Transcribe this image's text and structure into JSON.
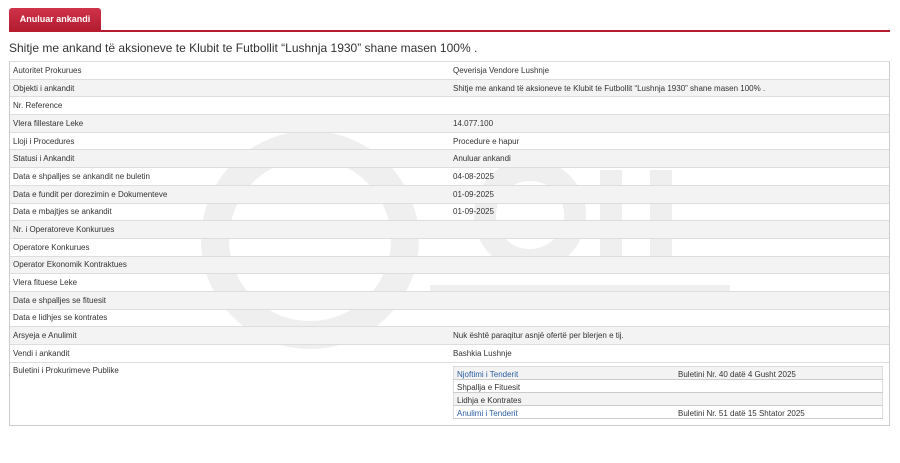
{
  "tab": {
    "label": "Anuluar ankandi"
  },
  "title": "Shitje me ankand të aksioneve te Klubit te Futbollit “Lushnja 1930” shane masen 100% .",
  "rows": [
    {
      "label": "Autoritet Prokurues",
      "value": "Qeverisja Vendore Lushnje"
    },
    {
      "label": "Objekti i ankandit",
      "value": "Shitje me ankand të aksioneve te Klubit te Futbollit “Lushnja 1930” shane masen 100% ."
    },
    {
      "label": "Nr. Reference",
      "value": ""
    },
    {
      "label": "Vlera fillestare Leke",
      "value": "14.077.100"
    },
    {
      "label": "Lloji i Procedures",
      "value": "Procedure e hapur"
    },
    {
      "label": "Statusi i Ankandit",
      "value": "Anuluar ankandi"
    },
    {
      "label": "Data e shpalljes se ankandit ne buletin",
      "value": "04-08-2025"
    },
    {
      "label": "Data e fundit per dorezimin e Dokumenteve",
      "value": "01-09-2025"
    },
    {
      "label": "Data e mbajtjes se ankandit",
      "value": "01-09-2025"
    },
    {
      "label": "Nr. i Operatoreve Konkurues",
      "value": ""
    },
    {
      "label": "Operatore Konkurues",
      "value": ""
    },
    {
      "label": "Operator Ekonomik Kontraktues",
      "value": ""
    },
    {
      "label": "Vlera fituese Leke",
      "value": ""
    },
    {
      "label": "Data e shpalljes se fituesit",
      "value": ""
    },
    {
      "label": "Data e lidhjes se kontrates",
      "value": ""
    },
    {
      "label": "Arsyeja e Anulimit",
      "value": "Nuk është paraqitur asnjë ofertë per blerjen e tij."
    },
    {
      "label": "Vendi i ankandit",
      "value": "Bashkia Lushnje"
    }
  ],
  "bulletin": {
    "label": "Buletini i Prokurimeve Publike",
    "items": [
      {
        "name": "Njoftimi i Tenderit",
        "ref": "Buletini Nr. 40 datë 4 Gusht 2025",
        "link": true
      },
      {
        "name": "Shpallja e Fituesit",
        "ref": "",
        "link": false
      },
      {
        "name": "Lidhja e Kontrates",
        "ref": "",
        "link": false
      },
      {
        "name": "Anulimi i Tenderit",
        "ref": "Buletini Nr. 51 datë 15 Shtator 2025",
        "link": true
      }
    ]
  },
  "colors": {
    "accent": "#c8283c",
    "link": "#2a5d9f"
  }
}
